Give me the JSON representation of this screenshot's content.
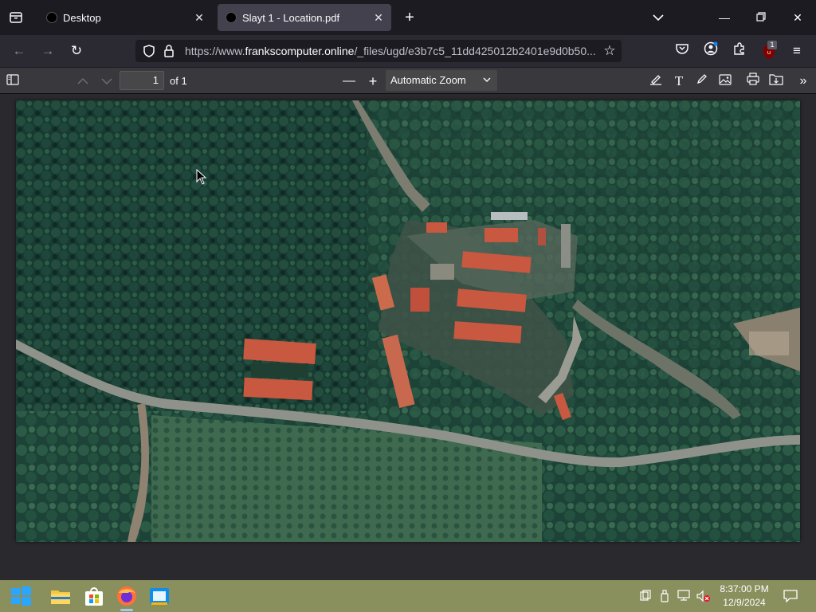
{
  "browser": {
    "tabs": [
      {
        "title": "Desktop",
        "active": false
      },
      {
        "title": "Slayt 1 - Location.pdf",
        "active": true
      }
    ],
    "url": {
      "prefix": "https://www.",
      "domain": "frankscomputer.online",
      "path": "/_files/ugd/e3b7c5_11dd425012b2401e9d0b50..."
    },
    "extension_badge": "1"
  },
  "pdf_toolbar": {
    "page_number": "1",
    "page_of": "of 1",
    "zoom_label": "Automatic Zoom"
  },
  "taskbar": {
    "time": "8:37:00 PM",
    "date": "12/9/2024"
  },
  "colors": {
    "accent": "#0a84ff",
    "tab_active": "#42414d",
    "taskbar": "#8a8f5e",
    "roof": "#c8583f"
  }
}
